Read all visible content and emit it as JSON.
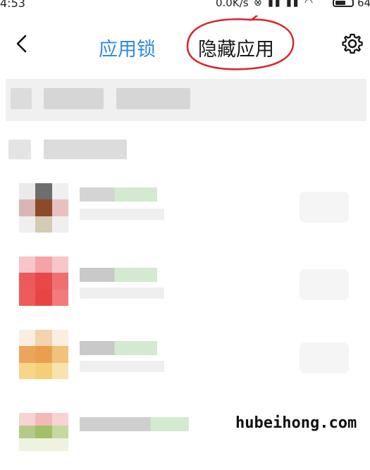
{
  "status_bar": {
    "time": "4:53",
    "speed": "0.0K/s",
    "battery": "64"
  },
  "header": {
    "back_icon": "chevron-left-icon",
    "tab_applock": "应用锁",
    "tab_hidden": "隐藏应用",
    "settings_icon": "gear-icon",
    "accent_color": "#2f8ae3",
    "annotation_color": "#d8262c"
  },
  "apps": [
    {
      "icon_colors": [
        "#6b4b3f",
        "#9b5a3a",
        "#cfc9b0"
      ]
    },
    {
      "icon_colors": [
        "#f2a6a8",
        "#e84c4c",
        "#f07a7a"
      ]
    },
    {
      "icon_colors": [
        "#e8a45a",
        "#f2c46a",
        "#f8ddb0"
      ]
    },
    {
      "icon_colors": [
        "#a9c46b",
        "#f0c6c6",
        "#d8e6b8"
      ]
    }
  ],
  "watermark": "hubeihong.com"
}
